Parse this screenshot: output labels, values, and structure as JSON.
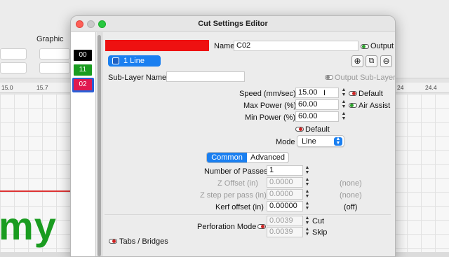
{
  "background": {
    "toolbar_label": "Graphic",
    "ruler_ticks": [
      "15.0",
      "15.7",
      "24",
      "24.4"
    ],
    "canvas_text": "my r"
  },
  "window": {
    "title": "Cut Settings Editor"
  },
  "layers": [
    {
      "label": "00",
      "color": "#000000",
      "text_color": "#ffffff"
    },
    {
      "label": "11",
      "color": "#1a9c20",
      "text_color": "#ffffff"
    },
    {
      "label": "02",
      "color": "#e0184f",
      "text_color": "#ffffff"
    }
  ],
  "header": {
    "layer_color": "#ee1111",
    "name_label": "Name",
    "name_value": "C02",
    "output_label": "Output",
    "line_badge": "1 Line",
    "sublayer_label": "Sub-Layer Name",
    "sublayer_value": "",
    "output_sublayer_label": "Output Sub-Layer"
  },
  "icons": [
    "add-icon",
    "copy-icon",
    "remove-icon"
  ],
  "speed": {
    "label": "Speed (mm/sec)",
    "value": "15.00",
    "default_label": "Default"
  },
  "max_power": {
    "label": "Max Power (%)",
    "value": "60.00",
    "air_assist_label": "Air Assist"
  },
  "min_power": {
    "label": "Min Power (%)",
    "value": "60.00",
    "default_label": "Default"
  },
  "mode": {
    "label": "Mode",
    "value": "Line"
  },
  "tabs": {
    "common": "Common",
    "advanced": "Advanced"
  },
  "passes": {
    "label": "Number of Passes",
    "value": "1"
  },
  "z_offset": {
    "label": "Z Offset (in)",
    "value": "0.0000",
    "note": "(none)"
  },
  "z_step": {
    "label": "Z step per pass (in)",
    "value": "0.0000",
    "note": "(none)"
  },
  "kerf": {
    "label": "Kerf offset (in)",
    "value": "0.00000",
    "note": "(off)"
  },
  "perforation": {
    "label": "Perforation Mode",
    "cut_value": "0.0039",
    "cut_label": "Cut",
    "skip_value": "0.0039",
    "skip_label": "Skip"
  },
  "tabs_bridges": {
    "label": "Tabs / Bridges"
  },
  "accent": "#1a7ff0"
}
